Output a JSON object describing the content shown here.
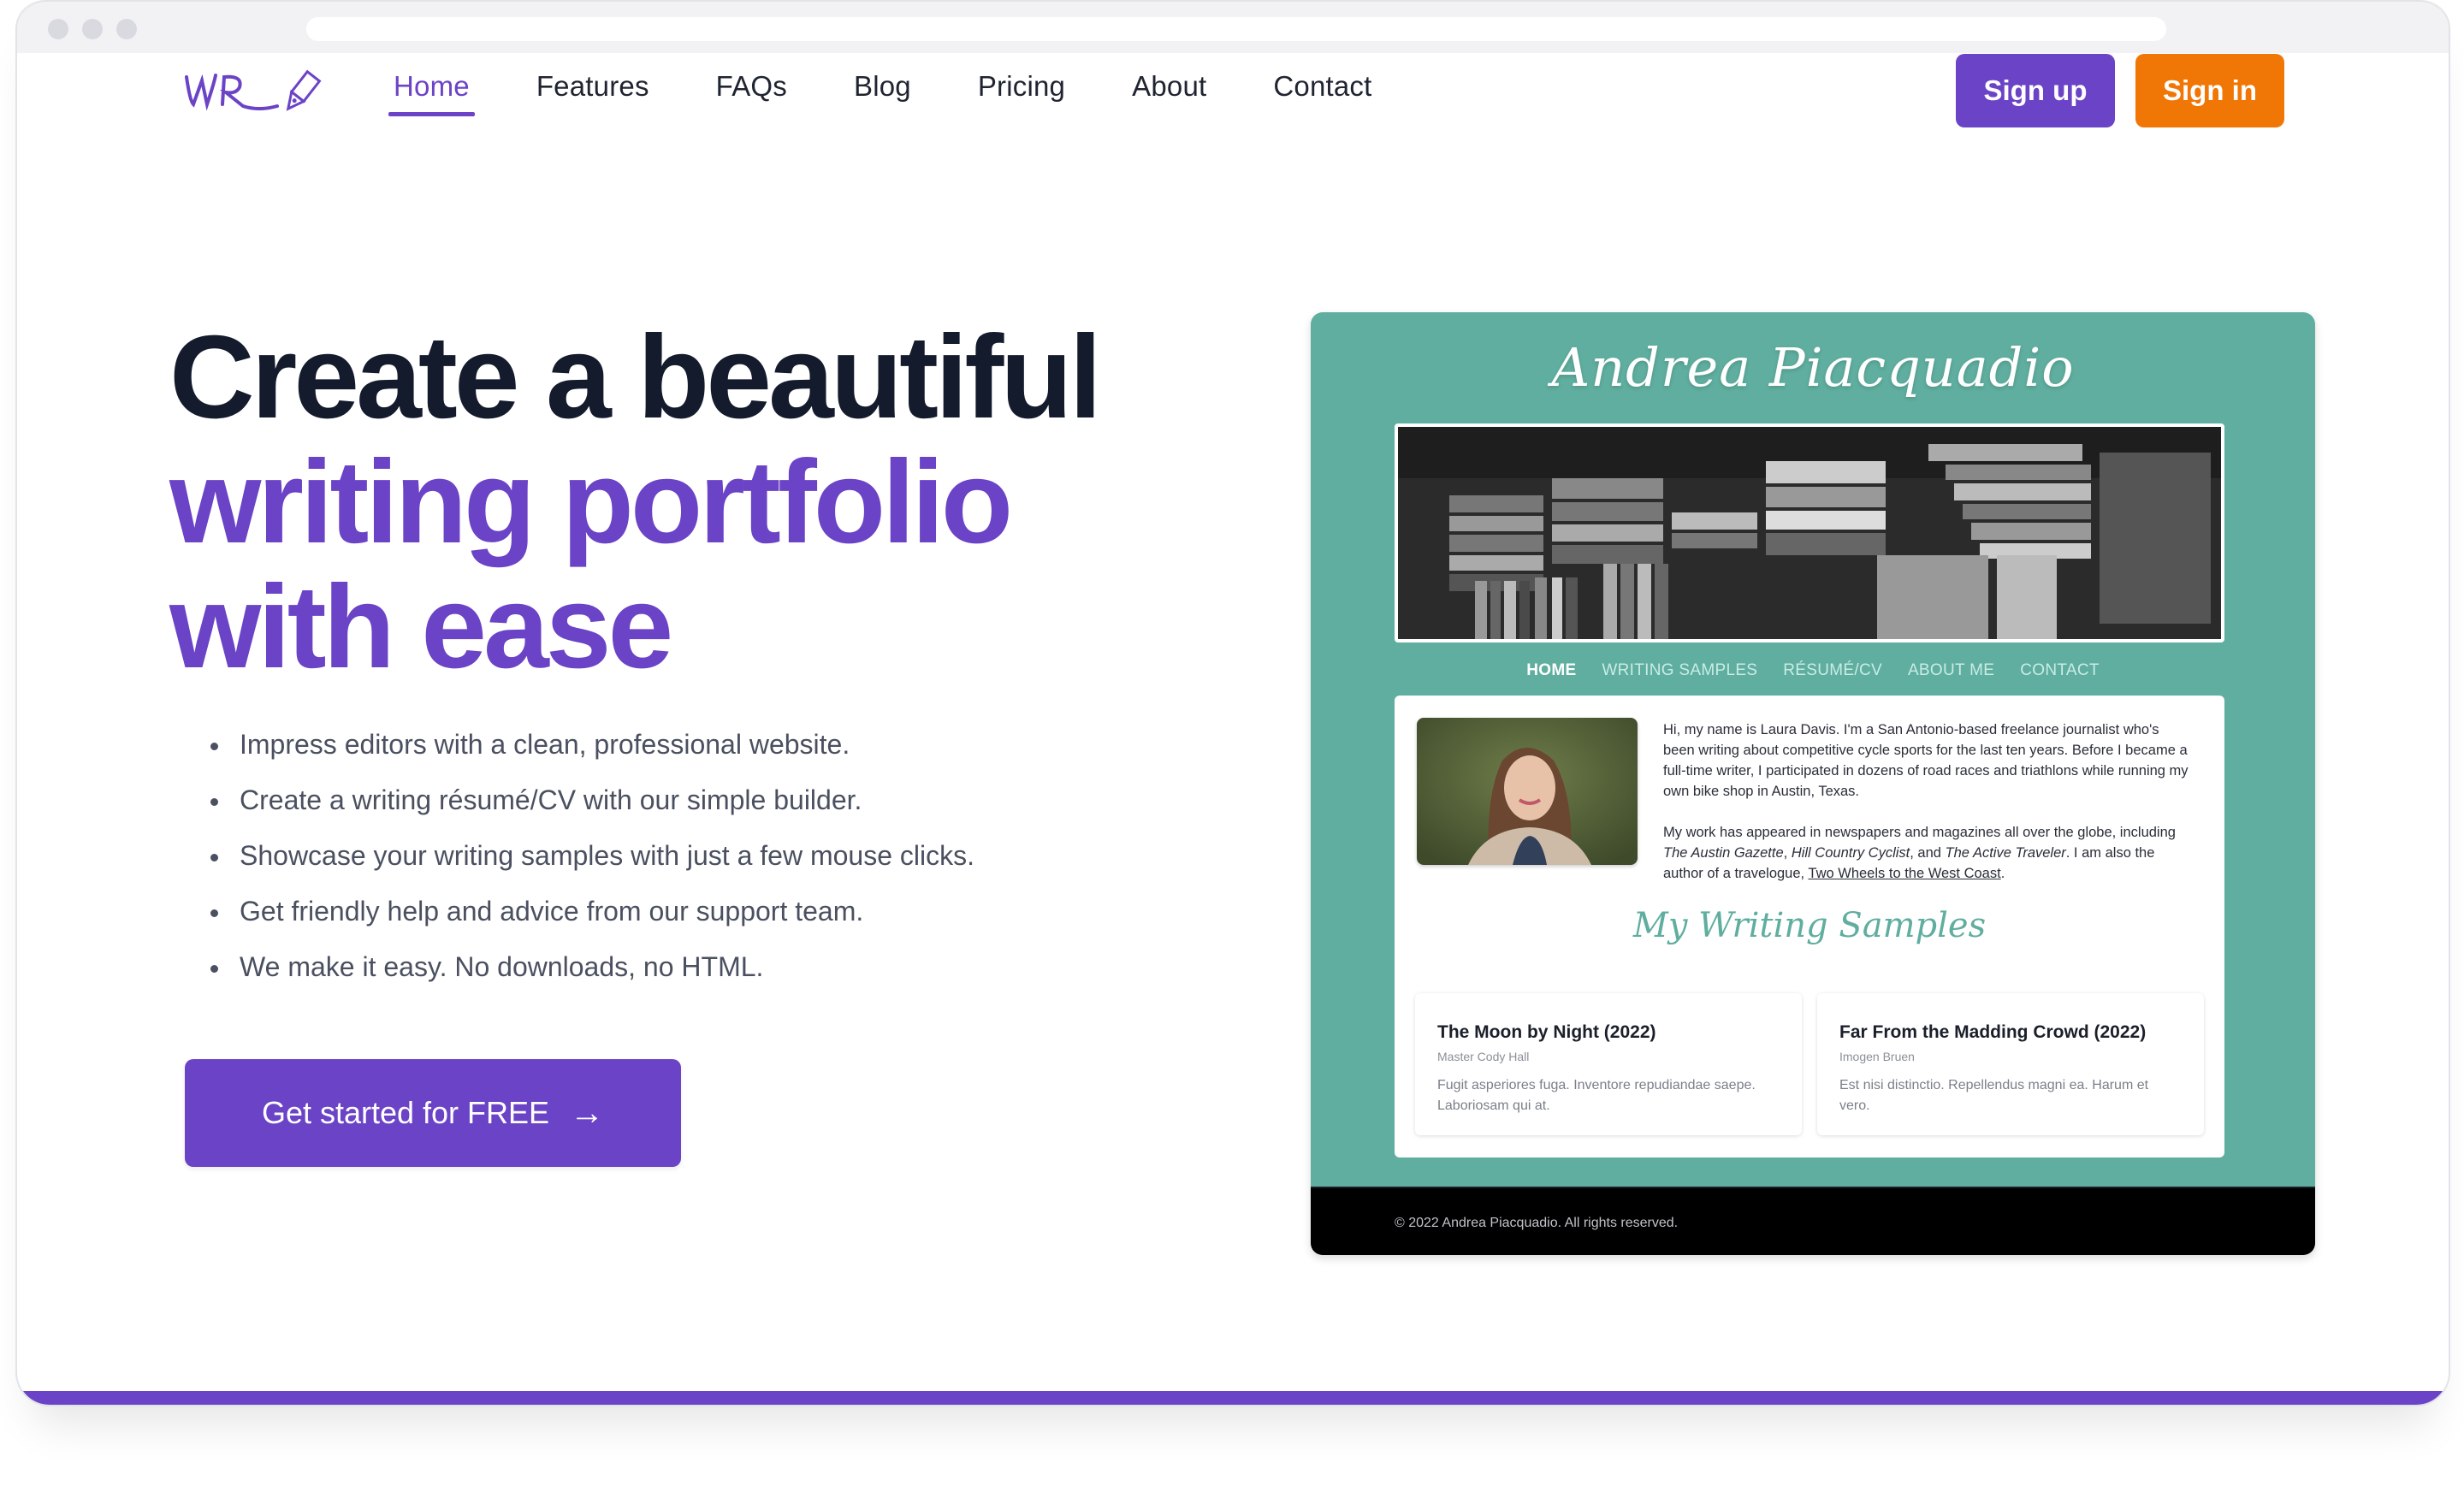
{
  "browser": {
    "window_controls": [
      "close",
      "minimize",
      "maximize"
    ],
    "url": ""
  },
  "header": {
    "logo_text": "WR",
    "logo_icon": "fountain-pen-icon",
    "nav": [
      {
        "label": "Home",
        "active": true
      },
      {
        "label": "Features",
        "active": false
      },
      {
        "label": "FAQs",
        "active": false
      },
      {
        "label": "Blog",
        "active": false
      },
      {
        "label": "Pricing",
        "active": false
      },
      {
        "label": "About",
        "active": false
      },
      {
        "label": "Contact",
        "active": false
      }
    ],
    "signup_label": "Sign up",
    "signin_label": "Sign in"
  },
  "hero": {
    "title_line1": "Create a beautiful",
    "title_line2": "writing portfolio",
    "title_line3": "with ease",
    "bullets": [
      "Impress editors with a clean, professional website.",
      "Create a writing résumé/CV with our simple builder.",
      "Showcase your writing samples with just a few mouse clicks.",
      "Get friendly help and advice from our support team.",
      "We make it easy. No downloads, no HTML."
    ],
    "cta_label": "Get started for FREE",
    "cta_icon": "arrow-right-icon"
  },
  "preview": {
    "site_name": "Andrea Piacquadio",
    "nav": [
      "HOME",
      "WRITING SAMPLES",
      "RÉSUMÉ/CV",
      "ABOUT ME",
      "CONTACT"
    ],
    "bio_p1": "Hi, my name is Laura Davis. I'm a San Antonio-based freelance journalist who's been writing about competitive cycle sports for the last ten years. Before I became a full-time writer, I participated in dozens of road races and triathlons while running my own bike shop in Austin, Texas.",
    "bio_p2_start": "My work has appeared in newspapers and magazines all over the globe, including ",
    "bio_pub1": "The Austin Gazette",
    "bio_sep1": ", ",
    "bio_pub2": "Hill Country Cyclist",
    "bio_sep2": ", and ",
    "bio_pub3": "The Active Traveler",
    "bio_mid": ". I am also the author of a travelogue, ",
    "bio_book": "Two Wheels to the West Coast",
    "bio_end": ".",
    "samples_title": "My Writing Samples",
    "samples": [
      {
        "title": "The Moon by Night (2022)",
        "author": "Master Cody Hall",
        "excerpt": "Fugit asperiores fuga. Inventore repudiandae saepe. Laboriosam qui at."
      },
      {
        "title": "Far From the Madding Crowd (2022)",
        "author": "Imogen Bruen",
        "excerpt": "Est nisi distinctio. Repellendus magni ea. Harum et vero."
      }
    ],
    "footer": "© 2022 Andrea Piacquadio. All rights reserved."
  },
  "colors": {
    "brand_purple": "#6b43c6",
    "signin_orange": "#f07605",
    "preview_teal": "#5fae9f",
    "heading_dark": "#141b2d"
  }
}
